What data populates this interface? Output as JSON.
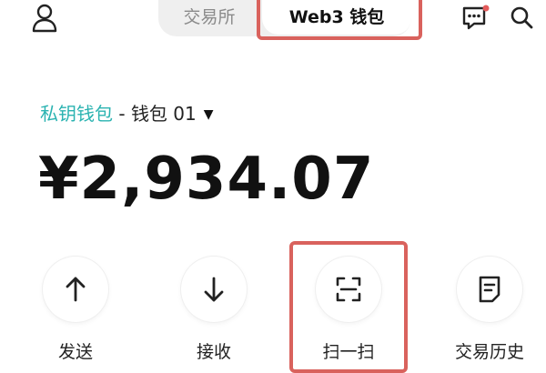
{
  "header": {
    "tabs": [
      {
        "label": "交易所",
        "selected": false
      },
      {
        "label": "Web3 钱包",
        "selected": true
      }
    ],
    "icons": [
      "profile-icon",
      "chat-icon",
      "search-icon"
    ],
    "notification_dot_color": "#e35b5b"
  },
  "wallet": {
    "type_label": "私钥钱包",
    "separator": " - ",
    "name": "钱包 01",
    "balance": "¥2,934.07"
  },
  "actions": [
    {
      "label": "发送",
      "icon": "arrow-up-icon"
    },
    {
      "label": "接收",
      "icon": "arrow-down-icon"
    },
    {
      "label": "扫一扫",
      "icon": "scan-icon"
    },
    {
      "label": "交易历史",
      "icon": "history-icon"
    }
  ],
  "colors": {
    "accent_teal": "#2bb3b1",
    "highlight_red": "#d9625d"
  }
}
